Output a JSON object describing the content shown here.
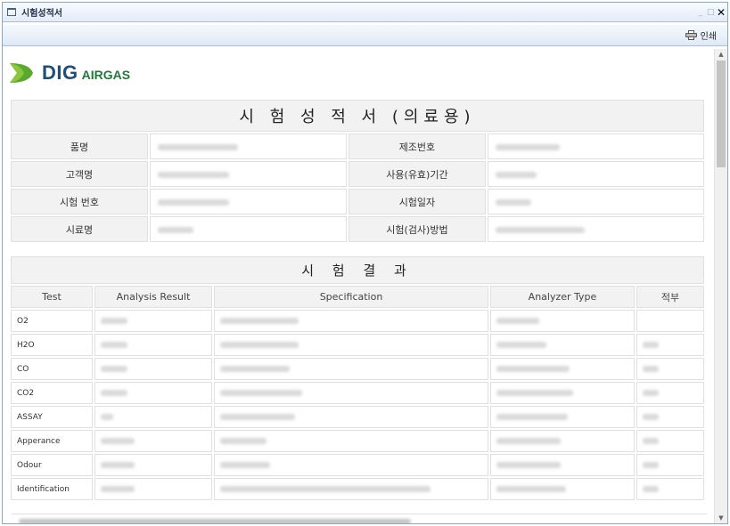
{
  "window": {
    "title": "시험성적서"
  },
  "toolbar": {
    "print_label": "인쇄"
  },
  "logo": {
    "brand_main": "DIG",
    "brand_sub": "AIRGAS",
    "colors": {
      "navy": "#1f4e79",
      "green": "#5aa82e"
    }
  },
  "document": {
    "title": "시 험 성 적 서 (의료용)",
    "info_rows": [
      {
        "label1": "품명",
        "label2": "제조번호"
      },
      {
        "label1": "고객명",
        "label2": "사용(유효)기간"
      },
      {
        "label1": "시험 번호",
        "label2": "시험일자"
      },
      {
        "label1": "시료명",
        "label2": "시험(검사)방법"
      }
    ]
  },
  "results": {
    "title": "시 험 결 과",
    "columns": [
      "Test",
      "Analysis Result",
      "Specification",
      "Analyzer Type",
      "적부"
    ],
    "rows": [
      {
        "test": "O2"
      },
      {
        "test": "H2O"
      },
      {
        "test": "CO"
      },
      {
        "test": "CO2"
      },
      {
        "test": "ASSAY"
      },
      {
        "test": "Apperance"
      },
      {
        "test": "Odour"
      },
      {
        "test": "Identification"
      }
    ]
  }
}
